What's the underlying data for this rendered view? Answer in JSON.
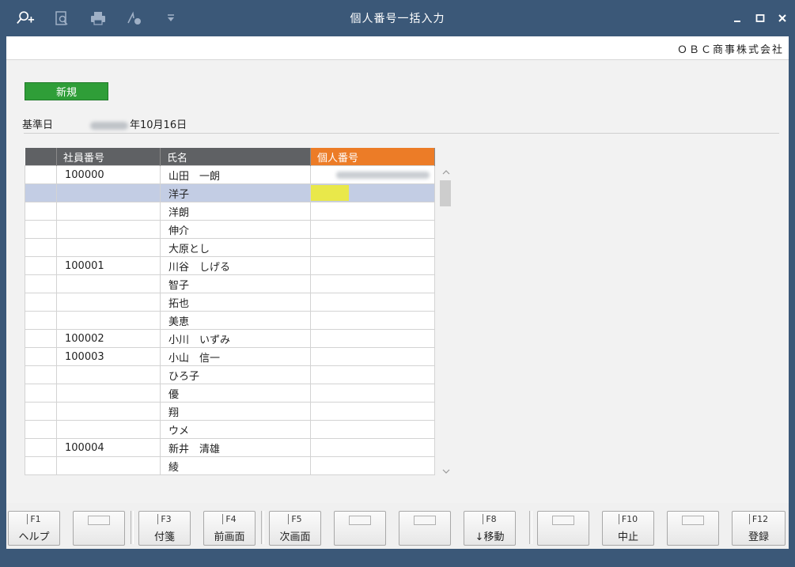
{
  "window": {
    "title": "個人番号一括入力"
  },
  "toolbar": {
    "icons": [
      "zoom-in-icon",
      "print-preview-icon",
      "print-icon",
      "sign-icon",
      "dropdown-icon"
    ]
  },
  "company": {
    "name": "ＯＢＣ商事株式会社"
  },
  "mode": {
    "label": "新規"
  },
  "base_date": {
    "label": "基準日",
    "value": "年10月16日"
  },
  "table": {
    "headers": [
      "",
      "社員番号",
      "氏名",
      "個人番号"
    ],
    "rows": [
      {
        "emp_no": "100000",
        "name": "山田　一朗"
      },
      {
        "emp_no": "",
        "name": "洋子"
      },
      {
        "emp_no": "",
        "name": "洋朗"
      },
      {
        "emp_no": "",
        "name": "伸介"
      },
      {
        "emp_no": "",
        "name": "大原とし"
      },
      {
        "emp_no": "100001",
        "name": "川谷　しげる"
      },
      {
        "emp_no": "",
        "name": "智子"
      },
      {
        "emp_no": "",
        "name": "拓也"
      },
      {
        "emp_no": "",
        "name": "美恵"
      },
      {
        "emp_no": "100002",
        "name": "小川　いずみ"
      },
      {
        "emp_no": "100003",
        "name": "小山　信一"
      },
      {
        "emp_no": "",
        "name": "ひろ子"
      },
      {
        "emp_no": "",
        "name": "優"
      },
      {
        "emp_no": "",
        "name": "翔"
      },
      {
        "emp_no": "",
        "name": "ウメ"
      },
      {
        "emp_no": "100004",
        "name": "新井　清雄"
      },
      {
        "emp_no": "",
        "name": "綾"
      }
    ]
  },
  "fkeys": {
    "f1": {
      "num": "F1",
      "label": "ヘルプ"
    },
    "f3": {
      "num": "F3",
      "label": "付箋"
    },
    "f4": {
      "num": "F4",
      "label": "前画面"
    },
    "f5": {
      "num": "F5",
      "label": "次画面"
    },
    "f8": {
      "num": "F8",
      "label": "↓移動"
    },
    "f10": {
      "num": "F10",
      "label": "中止"
    },
    "f12": {
      "num": "F12",
      "label": "登録"
    }
  },
  "colors": {
    "titlebar": "#3b5878",
    "new_badge": "#2f9e38",
    "highlight_header": "#ec7c27",
    "selected_row": "#c3cde4",
    "input_cell": "#e9e84a"
  }
}
